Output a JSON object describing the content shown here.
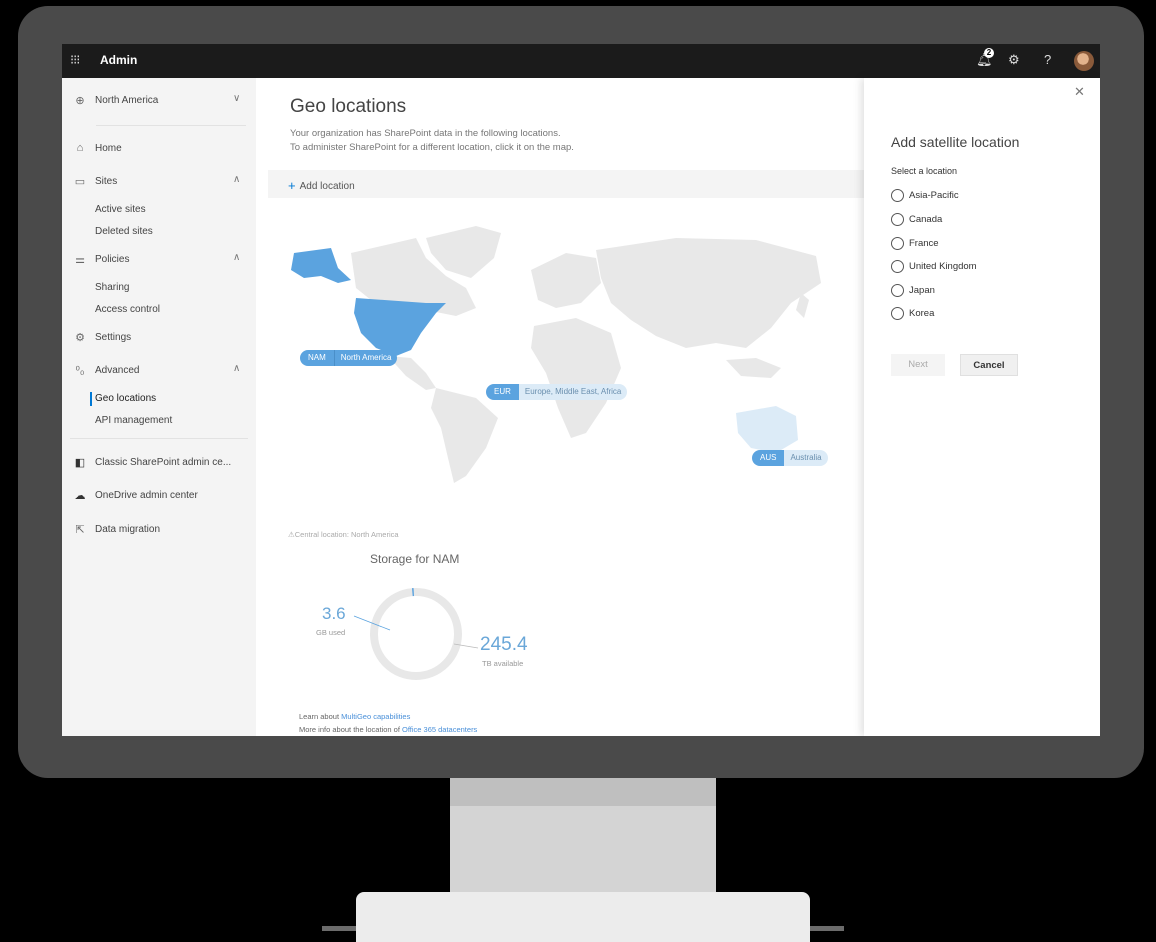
{
  "app": {
    "title": "Admin",
    "notification_count": "2"
  },
  "sidebar": {
    "region": "North America",
    "items": [
      {
        "label": "Home"
      },
      {
        "label": "Sites"
      },
      {
        "label": "Active sites"
      },
      {
        "label": "Deleted sites"
      },
      {
        "label": "Policies"
      },
      {
        "label": "Sharing"
      },
      {
        "label": "Access control"
      },
      {
        "label": "Settings"
      },
      {
        "label": "Advanced"
      },
      {
        "label": "Geo locations"
      },
      {
        "label": "API management"
      },
      {
        "label": "Classic SharePoint admin ce..."
      },
      {
        "label": "OneDrive admin center"
      },
      {
        "label": "Data migration"
      }
    ]
  },
  "main": {
    "title": "Geo locations",
    "description_line1": "Your organization has SharePoint data in the following locations.",
    "description_line2": "To administer SharePoint for a different location, click it on the map.",
    "add_location": "Add location",
    "map_labels": [
      {
        "code": "NAM",
        "name": "North America"
      },
      {
        "code": "EUR",
        "name": "Europe, Middle East, Africa"
      },
      {
        "code": "AUS",
        "name": "Australia"
      }
    ],
    "central_location": "Central location: North America",
    "storage": {
      "title": "Storage for NAM",
      "used_value": "3.6",
      "used_label": "GB used",
      "available_value": "245.4",
      "available_label": "TB available"
    },
    "learn_prefix": "Learn about ",
    "learn_link": "MultiGeo capabilities",
    "more_prefix": "More info about the location of ",
    "more_link": "Office 365 datacenters"
  },
  "panel": {
    "title": "Add satellite location",
    "select_label": "Select a location",
    "options": [
      "Asia-Pacific",
      "Canada",
      "France",
      "United Kingdom",
      "Japan",
      "Korea"
    ],
    "next_label": "Next",
    "cancel_label": "Cancel"
  },
  "colors": {
    "accent": "#0078d4",
    "map_highlight": "#5ba3df",
    "map_land": "#e6e6e6"
  }
}
